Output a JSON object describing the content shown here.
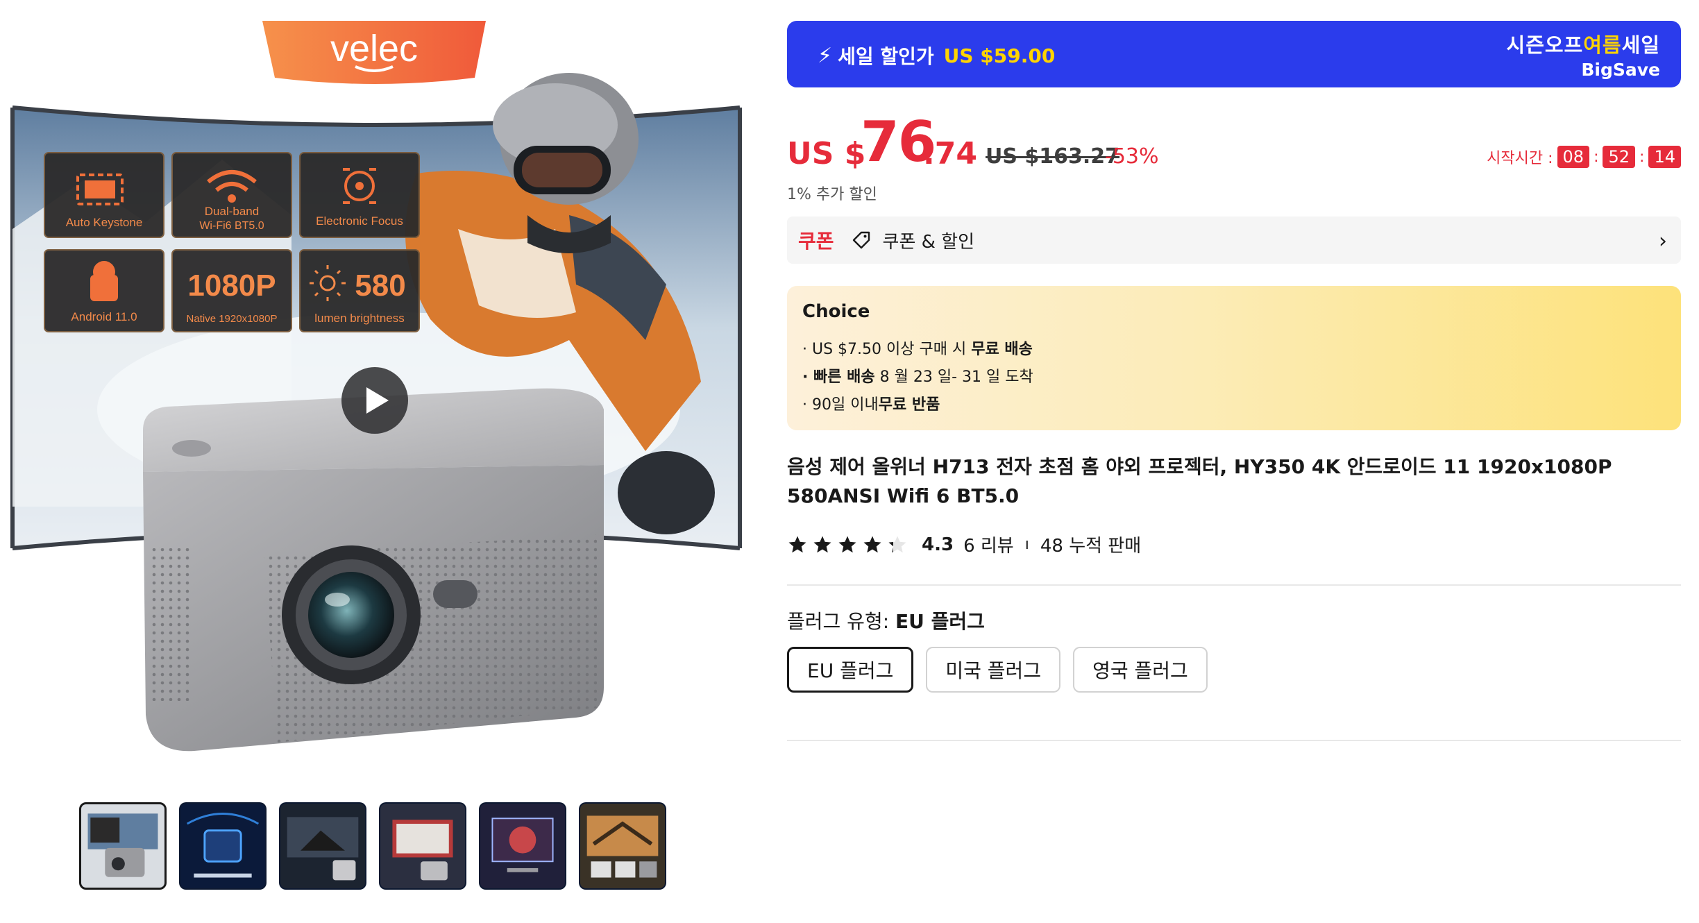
{
  "gallery": {
    "brand_logo": "velec",
    "features": [
      {
        "label": "Auto Keystone"
      },
      {
        "label": "Dual-band",
        "sub": "Wi-Fi6 BT5.0"
      },
      {
        "label": "Electronic Focus"
      },
      {
        "label": "Android 11.0"
      },
      {
        "big": "1080P",
        "label": "Native  1920x1080P"
      },
      {
        "big": "580",
        "label": "lumen brightness"
      }
    ],
    "thumbnail_count": 6,
    "active_thumbnail": 1
  },
  "sale_banner": {
    "label": "세일 할인가",
    "price": "US $59.00",
    "season_part1": "시즌오프",
    "season_highlight": "여름",
    "season_part2": "세일",
    "brand": "BigSave"
  },
  "price": {
    "currency": "US $",
    "integer": "76",
    "decimal": ".74",
    "original": "US $163.27",
    "discount": "-53%"
  },
  "timer": {
    "label": "시작시간 :",
    "hours": "08",
    "minutes": "52",
    "seconds": "14"
  },
  "extra_discount": "1% 추가 할인",
  "coupon": {
    "tag": "쿠폰",
    "label": "쿠폰 & 할인"
  },
  "choice": {
    "title": "Choice",
    "line1_pre": "· US $7.50 이상 구매 시 ",
    "line1_bold": "무료 배송",
    "line2_bold": "· 빠른 배송",
    "line2_post": " 8 월 23 일- 31 일 도착",
    "line3_pre": "· 90일 이내",
    "line3_bold": "무료 반품"
  },
  "product_title": "음성 제어 올위너 H713 전자 초점 홈 야외 프로젝터, HY350 4K 안드로이드 11 1920x1080P 580ANSI Wifi 6 BT5.0",
  "rating": {
    "score": "4.3",
    "reviews": "6 리뷰",
    "sales": "48 누적 판매",
    "stars_filled": 4.3
  },
  "plug": {
    "label": "플러그 유형: ",
    "selected_value": "EU 플러그",
    "options": [
      "EU 플러그",
      "미국 플러그",
      "영국 플러그"
    ]
  },
  "colors": {
    "accent_red": "#e62b3a",
    "banner_blue": "#2b3cec",
    "banner_yellow": "#ffd400"
  }
}
